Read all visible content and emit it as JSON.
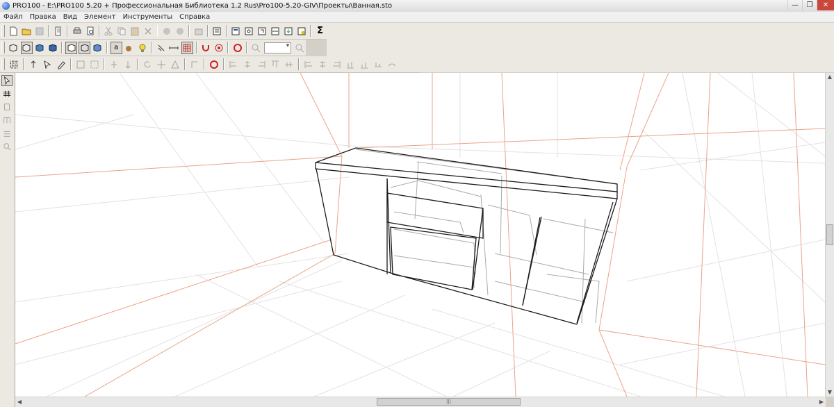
{
  "window": {
    "title": "PRO100 - E:\\PRO100 5.20 + Профессиональная Библиотека 1.2 Rus\\Pro100-5.20-GIV\\Проекты\\Ванная.sto",
    "minimize_glyph": "—",
    "maximize_glyph": "❐",
    "close_glyph": "✕"
  },
  "menu": {
    "items": [
      "Файл",
      "Правка",
      "Вид",
      "Элемент",
      "Инструменты",
      "Справка"
    ]
  },
  "toolbar3d": {
    "sigma_label": "Σ"
  },
  "toolbar_view": {
    "text_toggle_label": "a"
  },
  "colors": {
    "room_grid": "#e4e4e4",
    "room_edges": "#e8a080",
    "cabinet_outline": "#1a1a1a",
    "cabinet_inner": "#aaaaaa"
  },
  "scroll": {
    "hthumb_grip": "|||"
  }
}
